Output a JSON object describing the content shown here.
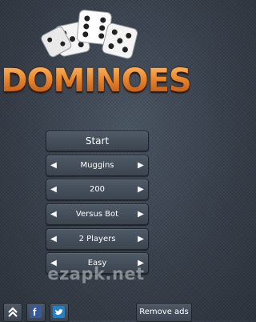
{
  "logo": {
    "title": "DOMINOES",
    "icon": "dice-icon"
  },
  "menu": {
    "start_label": "Start",
    "selectors": [
      {
        "name": "game-type",
        "value": "Muggins"
      },
      {
        "name": "points",
        "value": "200"
      },
      {
        "name": "opponent",
        "value": "Versus Bot"
      },
      {
        "name": "players",
        "value": "2 Players"
      },
      {
        "name": "difficulty",
        "value": "Easy"
      }
    ],
    "left_arrow": "◀",
    "right_arrow": "▶"
  },
  "watermark": "ezapk.net",
  "bottom_bar": {
    "icons": [
      "chevron-up-icon",
      "facebook-icon",
      "twitter-icon"
    ],
    "facebook_glyph": "f",
    "remove_ads_label": "Remove ads"
  },
  "colors": {
    "background": "#353d48",
    "button": "#444d59",
    "title_orange": "#e07a2a",
    "facebook_blue": "#3b5998",
    "twitter_blue": "#1da1f2"
  }
}
